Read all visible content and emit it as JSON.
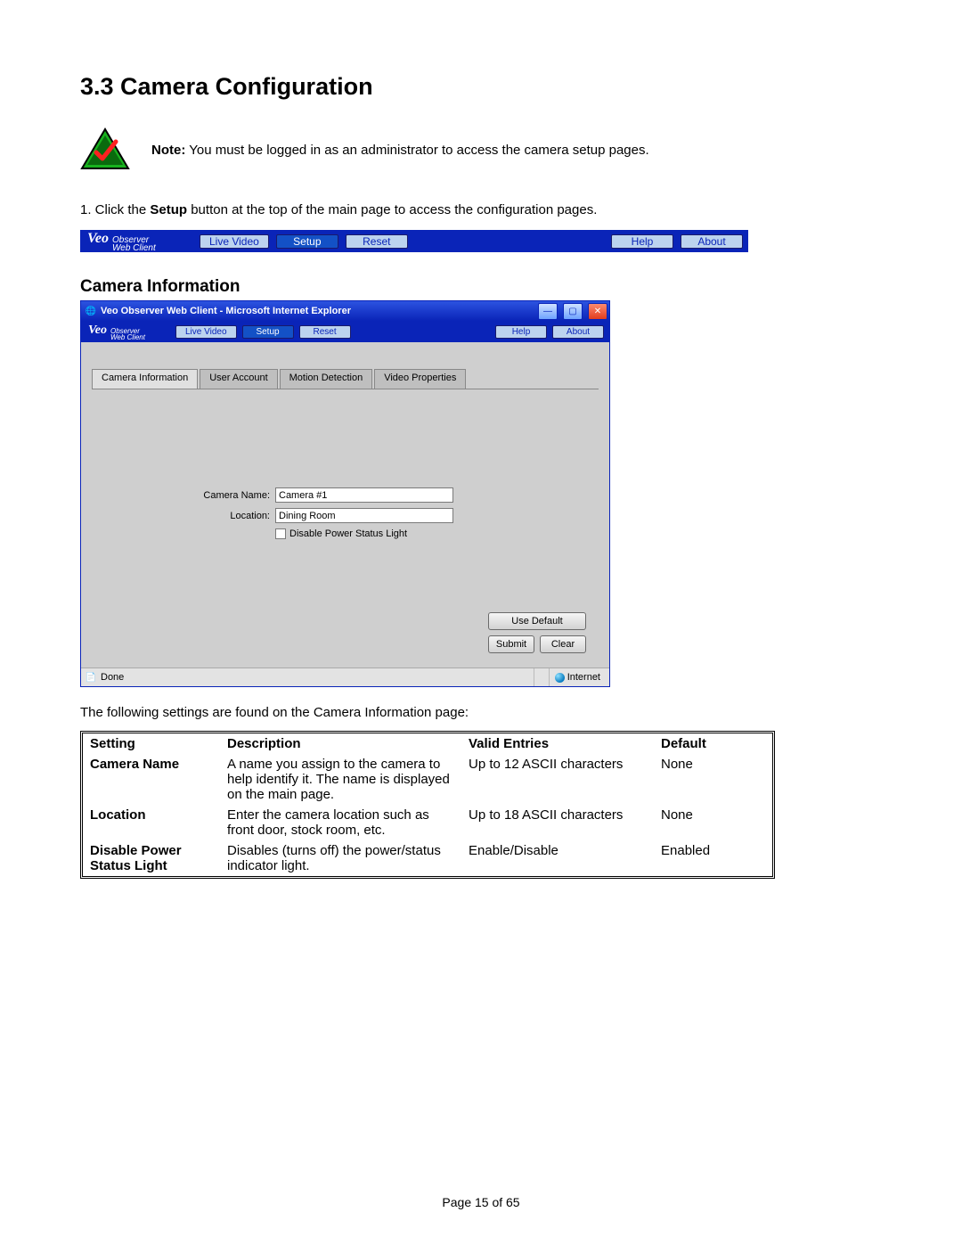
{
  "heading": "3.3 Camera Configuration",
  "note_label": "Note:",
  "note_body": "  You must be logged in as an administrator to access the camera setup pages.",
  "step1_pre": "1. Click the ",
  "step1_bold": "Setup",
  "step1_post": " button at the top of the main page to access the configuration pages.",
  "logo": {
    "brand": "Veo",
    "line1": "Observer",
    "line2": "Web Client"
  },
  "top_toolbar": {
    "live": "Live Video",
    "setup": "Setup",
    "reset": "Reset",
    "help": "Help",
    "about": "About"
  },
  "sub_heading": "Camera Information",
  "ie": {
    "title": "Veo Observer Web Client - Microsoft Internet Explorer",
    "tabs": {
      "camera_info": "Camera Information",
      "user_account": "User Account",
      "motion_detection": "Motion Detection",
      "video_properties": "Video Properties"
    },
    "form": {
      "camera_name_label": "Camera Name:",
      "camera_name_value": "Camera #1",
      "location_label": "Location:",
      "location_value": "Dining Room",
      "disable_psl": "Disable Power Status Light"
    },
    "buttons": {
      "use_default": "Use Default",
      "submit": "Submit",
      "clear": "Clear"
    },
    "status": {
      "done": "Done",
      "zone": "Internet"
    }
  },
  "lead": "The following settings are found on the Camera Information page:",
  "table": {
    "headers": {
      "setting": "Setting",
      "description": "Description",
      "valid": "Valid Entries",
      "default": "Default"
    },
    "rows": [
      {
        "setting": "Camera Name",
        "description": "A name you assign to the camera to help identify it. The name is displayed on the main page.",
        "valid": "Up to 12 ASCII characters",
        "default": "None"
      },
      {
        "setting": "Location",
        "description": "Enter the camera location such as front door, stock room, etc.",
        "valid": "Up to 18 ASCII characters",
        "default": "None"
      },
      {
        "setting": "Disable Power Status Light",
        "description": "Disables (turns off) the power/status indicator light.",
        "valid": "Enable/Disable",
        "default": "Enabled"
      }
    ]
  },
  "footer": "Page 15 of 65"
}
